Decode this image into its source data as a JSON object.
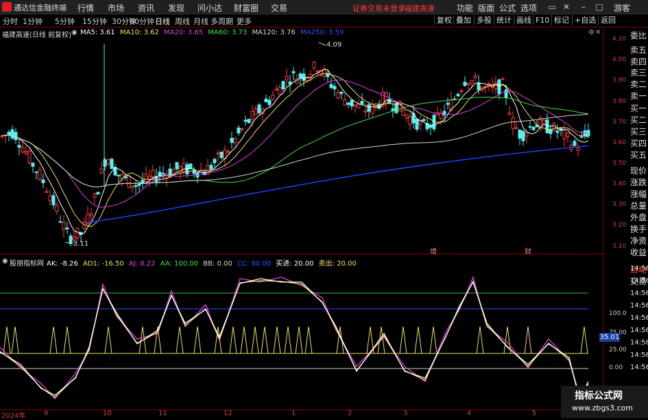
{
  "menubar": {
    "app_title": "通达信金融终端",
    "items": [
      "行情",
      "市场",
      "资讯",
      "发现",
      "问小达",
      "财富圈",
      "交易"
    ],
    "warning": "证券交易未登录",
    "stock_name": "福建高速",
    "right_items": [
      "功能",
      "版面",
      "公式",
      "选项"
    ],
    "user": "游客"
  },
  "toolbar": {
    "periods": [
      "分时",
      "1分钟",
      "5分钟",
      "15分钟",
      "30分钟",
      "60分钟",
      "日线",
      "周线",
      "月线",
      "多周期",
      "更多"
    ],
    "active_period": "日线",
    "right_buttons": [
      "复权",
      "叠加",
      "多股",
      "统计",
      "画线",
      "F10",
      "标记",
      "+自选",
      "返回"
    ]
  },
  "main_chart": {
    "title": "福建高速(日线 前复权)",
    "ma": [
      {
        "label": "MA5: 3.61",
        "color": "#ffffff"
      },
      {
        "label": "MA10: 3.62",
        "color": "#f0e060"
      },
      {
        "label": "MA20: 3.65",
        "color": "#e040e0"
      },
      {
        "label": "MA60: 3.73",
        "color": "#40e040"
      },
      {
        "label": "MA120: 3.76",
        "color": "#d8d8d8"
      },
      {
        "label": "MA250: 3.59",
        "color": "#3050ff"
      }
    ],
    "y_ticks": [
      "4.10",
      "4.00",
      "3.90",
      "3.80",
      "3.70",
      "3.60",
      "3.50",
      "3.40",
      "3.30",
      "3.20",
      "3.10"
    ],
    "high_label": "4.09",
    "low_label": "3.11",
    "markers": [
      "增",
      "财"
    ]
  },
  "sub_chart": {
    "title": "股朋指标网",
    "values": [
      {
        "label": "AK: -8.26",
        "color": "#ffffff"
      },
      {
        "label": "AD1: -16.50",
        "color": "#f0e060"
      },
      {
        "label": "AJ: 8.22",
        "color": "#e040e0"
      },
      {
        "label": "AA: 100.00",
        "color": "#40e040"
      },
      {
        "label": "BB: 0.00",
        "color": "#d8d8d8"
      },
      {
        "label": "CC: 80.00",
        "color": "#3050ff"
      },
      {
        "label": "买进: 20.00",
        "color": "#ffffff"
      },
      {
        "label": "卖出: 20.00",
        "color": "#f0e060"
      }
    ],
    "y_ticks": [
      "100.0",
      "75.00",
      "50.00",
      "25.00",
      "0.00"
    ],
    "current_badge": "35.01"
  },
  "x_axis": [
    "2024年",
    "9",
    "10",
    "11",
    "12",
    "1",
    "2",
    "3",
    "4",
    "5"
  ],
  "right_panel": {
    "labels": [
      "委比",
      "卖五",
      "卖四",
      "卖三",
      "卖二",
      "卖一",
      "买一",
      "买二",
      "买三",
      "买四",
      "买五",
      "现价",
      "涨跌",
      "涨幅",
      "总量",
      "外盘",
      "换手",
      "净资",
      "收益",
      "自动",
      "交易"
    ],
    "time_labels": [
      "14:56",
      "14:56",
      "14:56",
      "14:56",
      "14:56",
      "14:56",
      "14:56",
      "14:56",
      "14:56"
    ]
  },
  "watermark": {
    "line1": "指标公式网",
    "line2": "www.zbgs3.com"
  }
}
